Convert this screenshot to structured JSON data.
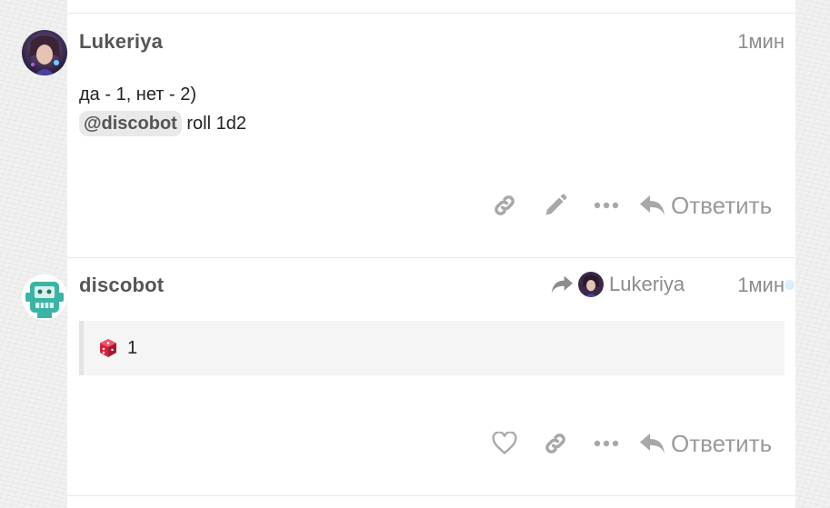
{
  "posts": [
    {
      "username": "Lukeriya",
      "time": "1мин",
      "lines": [
        "да - 1, нет - 2)"
      ],
      "mention": "@discobot",
      "mention_rest": " roll 1d2",
      "actions": {
        "reply_label": "Ответить",
        "icons": [
          "link-icon",
          "edit-icon",
          "more-icon",
          "reply-icon"
        ]
      }
    },
    {
      "username": "discobot",
      "time": "1мин",
      "reply_to": "Lukeriya",
      "result": "1",
      "actions": {
        "reply_label": "Ответить",
        "icons": [
          "heart-icon",
          "link-icon",
          "more-icon",
          "reply-icon"
        ]
      }
    }
  ],
  "colors": {
    "username": "#555555",
    "muted": "#8c8c8c",
    "icon": "#a8a8a8",
    "discobot_avatar": "#3cb4a5",
    "dice": "#d4233f",
    "unread_dot": "#d7efff"
  }
}
